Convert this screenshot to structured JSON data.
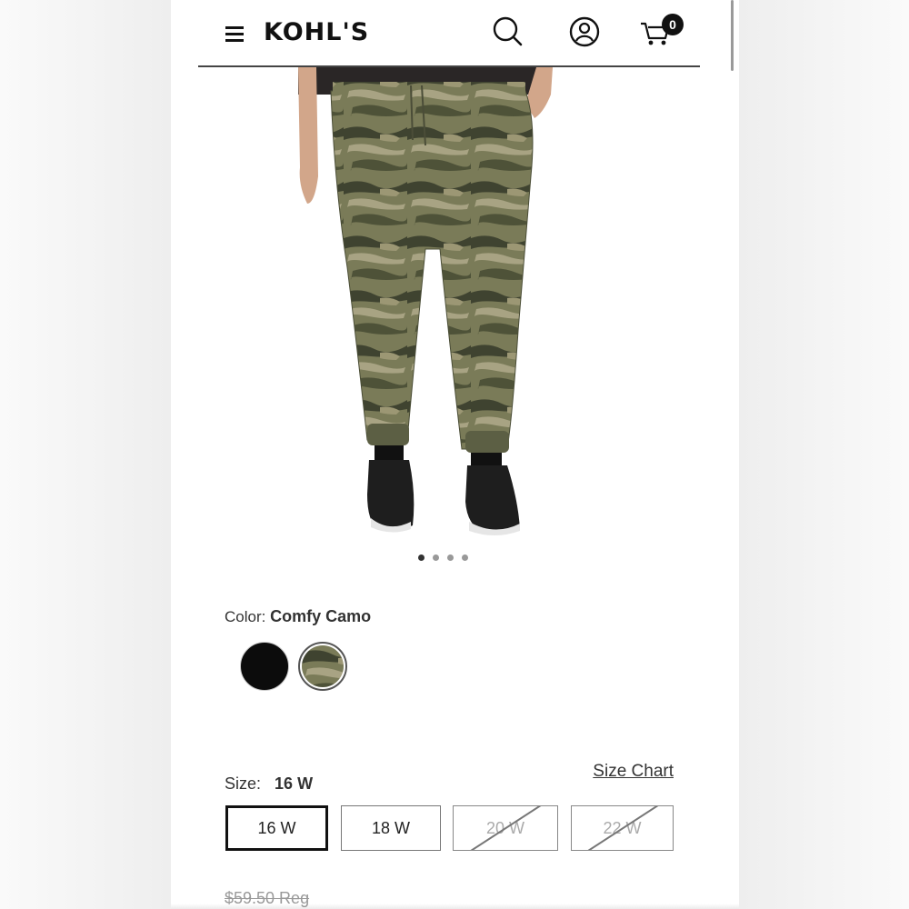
{
  "header": {
    "logo": "KOHL'S",
    "cart_count": "0"
  },
  "gallery": {
    "image_count": 4,
    "active_index": 0
  },
  "color": {
    "label": "Color:",
    "selected": "Comfy Camo",
    "options": [
      "Black",
      "Comfy Camo"
    ]
  },
  "size": {
    "label": "Size:",
    "selected": "16 W",
    "chart_link": "Size Chart",
    "options": [
      {
        "label": "16 W",
        "available": true
      },
      {
        "label": "18 W",
        "available": true
      },
      {
        "label": "20 W",
        "available": false
      },
      {
        "label": "22 W",
        "available": false
      }
    ]
  },
  "price": {
    "regular": "$59.50 Reg"
  },
  "colors": {
    "camo_light": "#8b8a6a",
    "camo_mid": "#6b6d4a",
    "camo_dark": "#3f4330",
    "shirt": "#2a2626",
    "skin": "#d2a68a"
  }
}
